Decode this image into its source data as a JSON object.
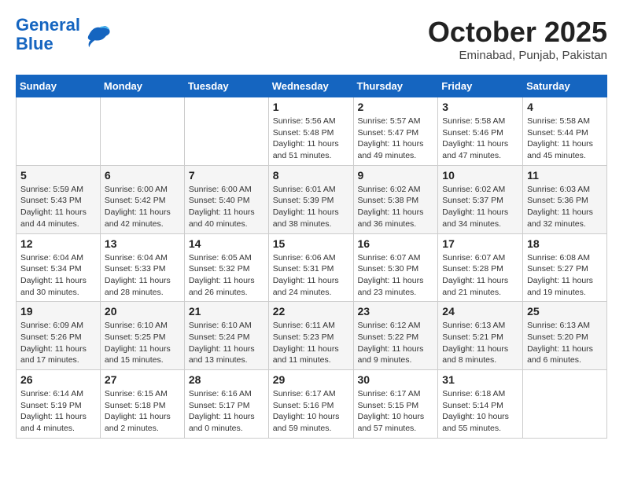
{
  "header": {
    "logo_line1": "General",
    "logo_line2": "Blue",
    "month": "October 2025",
    "location": "Eminabad, Punjab, Pakistan"
  },
  "days_of_week": [
    "Sunday",
    "Monday",
    "Tuesday",
    "Wednesday",
    "Thursday",
    "Friday",
    "Saturday"
  ],
  "weeks": [
    [
      {
        "day": "",
        "info": ""
      },
      {
        "day": "",
        "info": ""
      },
      {
        "day": "",
        "info": ""
      },
      {
        "day": "1",
        "info": "Sunrise: 5:56 AM\nSunset: 5:48 PM\nDaylight: 11 hours\nand 51 minutes."
      },
      {
        "day": "2",
        "info": "Sunrise: 5:57 AM\nSunset: 5:47 PM\nDaylight: 11 hours\nand 49 minutes."
      },
      {
        "day": "3",
        "info": "Sunrise: 5:58 AM\nSunset: 5:46 PM\nDaylight: 11 hours\nand 47 minutes."
      },
      {
        "day": "4",
        "info": "Sunrise: 5:58 AM\nSunset: 5:44 PM\nDaylight: 11 hours\nand 45 minutes."
      }
    ],
    [
      {
        "day": "5",
        "info": "Sunrise: 5:59 AM\nSunset: 5:43 PM\nDaylight: 11 hours\nand 44 minutes."
      },
      {
        "day": "6",
        "info": "Sunrise: 6:00 AM\nSunset: 5:42 PM\nDaylight: 11 hours\nand 42 minutes."
      },
      {
        "day": "7",
        "info": "Sunrise: 6:00 AM\nSunset: 5:40 PM\nDaylight: 11 hours\nand 40 minutes."
      },
      {
        "day": "8",
        "info": "Sunrise: 6:01 AM\nSunset: 5:39 PM\nDaylight: 11 hours\nand 38 minutes."
      },
      {
        "day": "9",
        "info": "Sunrise: 6:02 AM\nSunset: 5:38 PM\nDaylight: 11 hours\nand 36 minutes."
      },
      {
        "day": "10",
        "info": "Sunrise: 6:02 AM\nSunset: 5:37 PM\nDaylight: 11 hours\nand 34 minutes."
      },
      {
        "day": "11",
        "info": "Sunrise: 6:03 AM\nSunset: 5:36 PM\nDaylight: 11 hours\nand 32 minutes."
      }
    ],
    [
      {
        "day": "12",
        "info": "Sunrise: 6:04 AM\nSunset: 5:34 PM\nDaylight: 11 hours\nand 30 minutes."
      },
      {
        "day": "13",
        "info": "Sunrise: 6:04 AM\nSunset: 5:33 PM\nDaylight: 11 hours\nand 28 minutes."
      },
      {
        "day": "14",
        "info": "Sunrise: 6:05 AM\nSunset: 5:32 PM\nDaylight: 11 hours\nand 26 minutes."
      },
      {
        "day": "15",
        "info": "Sunrise: 6:06 AM\nSunset: 5:31 PM\nDaylight: 11 hours\nand 24 minutes."
      },
      {
        "day": "16",
        "info": "Sunrise: 6:07 AM\nSunset: 5:30 PM\nDaylight: 11 hours\nand 23 minutes."
      },
      {
        "day": "17",
        "info": "Sunrise: 6:07 AM\nSunset: 5:28 PM\nDaylight: 11 hours\nand 21 minutes."
      },
      {
        "day": "18",
        "info": "Sunrise: 6:08 AM\nSunset: 5:27 PM\nDaylight: 11 hours\nand 19 minutes."
      }
    ],
    [
      {
        "day": "19",
        "info": "Sunrise: 6:09 AM\nSunset: 5:26 PM\nDaylight: 11 hours\nand 17 minutes."
      },
      {
        "day": "20",
        "info": "Sunrise: 6:10 AM\nSunset: 5:25 PM\nDaylight: 11 hours\nand 15 minutes."
      },
      {
        "day": "21",
        "info": "Sunrise: 6:10 AM\nSunset: 5:24 PM\nDaylight: 11 hours\nand 13 minutes."
      },
      {
        "day": "22",
        "info": "Sunrise: 6:11 AM\nSunset: 5:23 PM\nDaylight: 11 hours\nand 11 minutes."
      },
      {
        "day": "23",
        "info": "Sunrise: 6:12 AM\nSunset: 5:22 PM\nDaylight: 11 hours\nand 9 minutes."
      },
      {
        "day": "24",
        "info": "Sunrise: 6:13 AM\nSunset: 5:21 PM\nDaylight: 11 hours\nand 8 minutes."
      },
      {
        "day": "25",
        "info": "Sunrise: 6:13 AM\nSunset: 5:20 PM\nDaylight: 11 hours\nand 6 minutes."
      }
    ],
    [
      {
        "day": "26",
        "info": "Sunrise: 6:14 AM\nSunset: 5:19 PM\nDaylight: 11 hours\nand 4 minutes."
      },
      {
        "day": "27",
        "info": "Sunrise: 6:15 AM\nSunset: 5:18 PM\nDaylight: 11 hours\nand 2 minutes."
      },
      {
        "day": "28",
        "info": "Sunrise: 6:16 AM\nSunset: 5:17 PM\nDaylight: 11 hours\nand 0 minutes."
      },
      {
        "day": "29",
        "info": "Sunrise: 6:17 AM\nSunset: 5:16 PM\nDaylight: 10 hours\nand 59 minutes."
      },
      {
        "day": "30",
        "info": "Sunrise: 6:17 AM\nSunset: 5:15 PM\nDaylight: 10 hours\nand 57 minutes."
      },
      {
        "day": "31",
        "info": "Sunrise: 6:18 AM\nSunset: 5:14 PM\nDaylight: 10 hours\nand 55 minutes."
      },
      {
        "day": "",
        "info": ""
      }
    ]
  ]
}
